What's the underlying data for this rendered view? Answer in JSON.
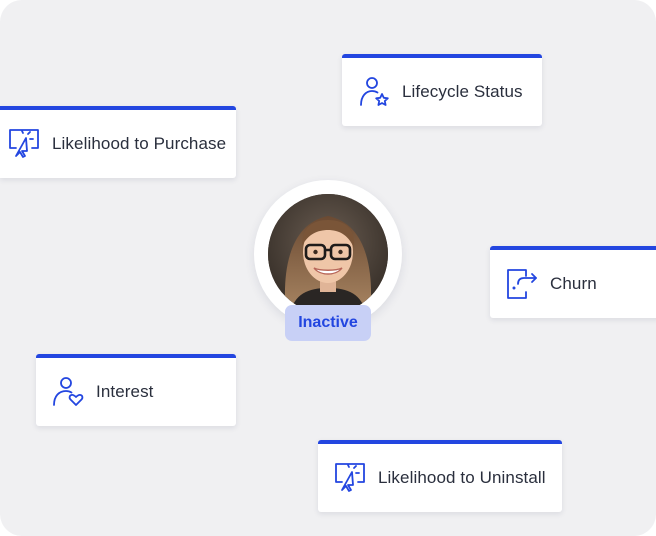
{
  "cards": {
    "lifecycle_status": {
      "label": "Lifecycle Status",
      "icon": "user-star-icon"
    },
    "likelihood_to_purchase": {
      "label": "Likelihood to Purchase",
      "icon": "screen-cursor-click-icon"
    },
    "churn": {
      "label": "Churn",
      "icon": "exit-arrow-icon"
    },
    "interest": {
      "label": "Interest",
      "icon": "user-heart-icon"
    },
    "likelihood_to_uninstall": {
      "label": "Likelihood to Uninstall",
      "icon": "screen-cursor-click-icon"
    }
  },
  "profile": {
    "status": "Inactive",
    "avatar": "avatar-photo"
  },
  "colors": {
    "accent": "#2346e0",
    "badge_bg": "#c8d0f6",
    "background": "#f0f0f2",
    "text": "#2a2f3d"
  }
}
